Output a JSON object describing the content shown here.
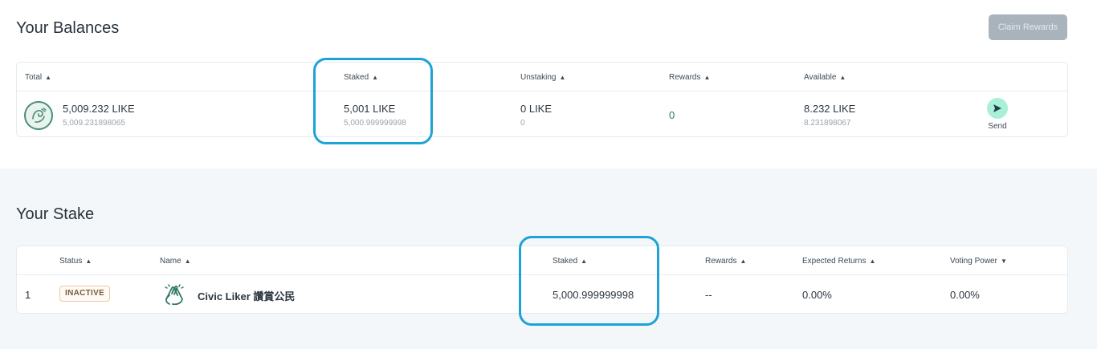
{
  "balances": {
    "title": "Your Balances",
    "claim_label": "Claim Rewards",
    "headers": {
      "total": "Total",
      "staked": "Staked",
      "unstaking": "Unstaking",
      "rewards": "Rewards",
      "available": "Available"
    },
    "sort_arrow": "▲",
    "row": {
      "total_main": "5,009.232 LIKE",
      "total_sub": "5,009.231898065",
      "staked_main": "5,001 LIKE",
      "staked_sub": "5,000.999999998",
      "unstaking_main": "0 LIKE",
      "unstaking_sub": "0",
      "rewards": "0",
      "available_main": "8.232 LIKE",
      "available_sub": "8.231898067",
      "send_label": "Send"
    }
  },
  "stake": {
    "title": "Your Stake",
    "headers": {
      "status": "Status",
      "name": "Name",
      "staked": "Staked",
      "rewards": "Rewards",
      "expected_returns": "Expected Returns",
      "voting_power": "Voting Power"
    },
    "sort_up": "▲",
    "sort_down": "▼",
    "rows": [
      {
        "index": "1",
        "status": "INACTIVE",
        "name": "Civic Liker 讚賞公民",
        "staked": "5,000.999999998",
        "rewards": "--",
        "expected_returns": "0.00%",
        "voting_power": "0.00%"
      }
    ]
  },
  "colors": {
    "accent": "#2f7866",
    "highlight": "#1ea3d6",
    "send_button": "#aaf0d8",
    "inactive_badge_border": "#e8c9a6"
  },
  "icons": {
    "coin": "like-coin-icon",
    "send": "send-arrow-icon",
    "validator": "clapping-hands-icon"
  }
}
